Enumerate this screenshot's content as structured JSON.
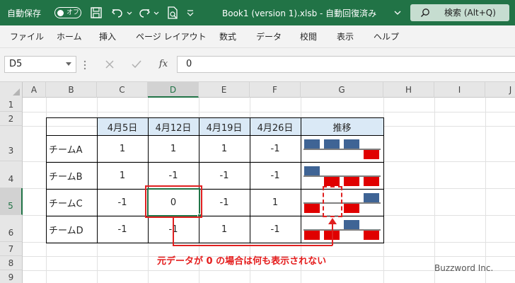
{
  "titlebar": {
    "autosave_label": "自動保存",
    "autosave_state": "オフ",
    "doc_title": "Book1 (version 1).xlsb  -  自動回復済み",
    "search_label": "検索 (Alt+Q)",
    "bg_color": "#217346"
  },
  "ribbon": {
    "tabs": [
      "ファイル",
      "ホーム",
      "挿入",
      "ページ レイアウト",
      "数式",
      "データ",
      "校閲",
      "表示",
      "ヘルプ"
    ]
  },
  "formula_bar": {
    "name_box": "D5",
    "fx": "fx",
    "value": "0"
  },
  "columns": [
    "A",
    "B",
    "C",
    "D",
    "E",
    "F",
    "G",
    "H",
    "I",
    "J"
  ],
  "rows": [
    "1",
    "2",
    "3",
    "4",
    "5",
    "6",
    "7",
    "8",
    "9"
  ],
  "table": {
    "header": [
      "4月5日",
      "4月12日",
      "4月19日",
      "4月26日",
      "推移"
    ],
    "teams": [
      "チームA",
      "チームB",
      "チームC",
      "チームD"
    ],
    "values": [
      [
        "1",
        "1",
        "1",
        "-1"
      ],
      [
        "1",
        "-1",
        "-1",
        "-1"
      ],
      [
        "-1",
        "0",
        "-1",
        "1"
      ],
      [
        "-1",
        "-1",
        "1",
        "-1"
      ]
    ]
  },
  "colors": {
    "win": "#3f6495",
    "loss": "#e00000",
    "header_fill": "#dae9f6",
    "selection": "#217346",
    "annotation": "#e41c1c"
  },
  "annotation": {
    "text": "元データが  0  の場合は何も表示されない"
  },
  "watermark": "Buzzword Inc."
}
